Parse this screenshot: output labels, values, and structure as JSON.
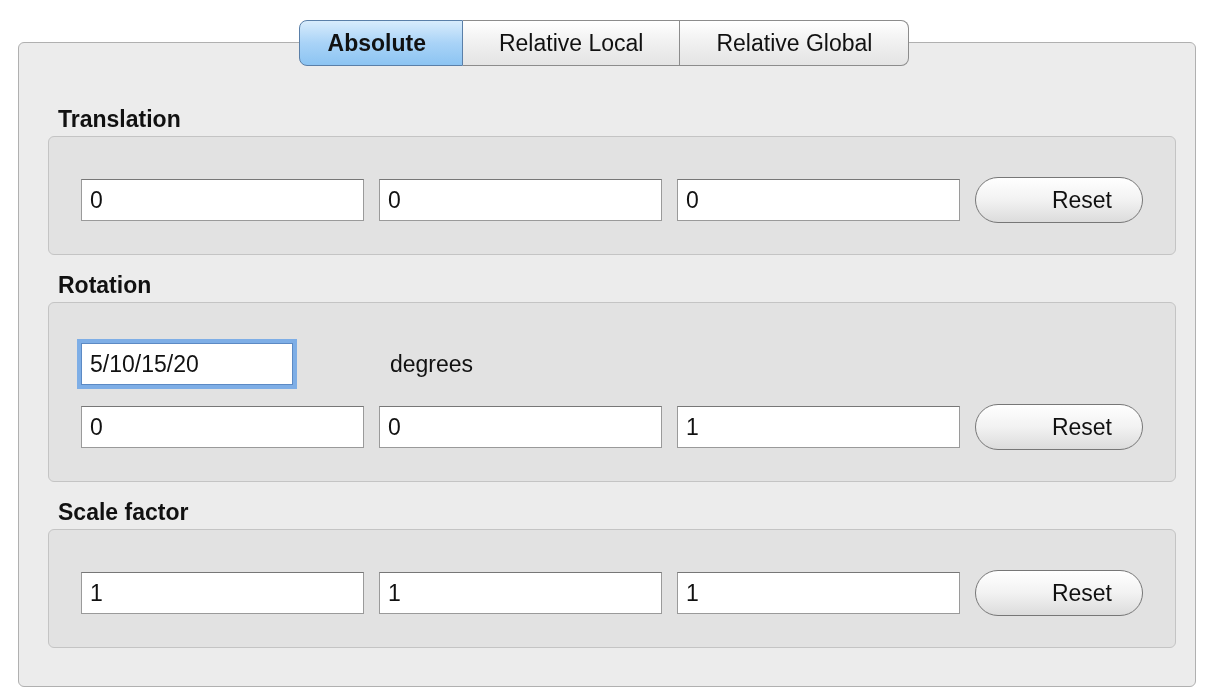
{
  "tabs": [
    {
      "label": "Absolute",
      "selected": true
    },
    {
      "label": "Relative Local",
      "selected": false
    },
    {
      "label": "Relative Global",
      "selected": false
    }
  ],
  "sections": [
    {
      "title": "Translation",
      "fields": [
        "0",
        "0",
        "0"
      ],
      "reset": "Reset"
    },
    {
      "title": "Rotation",
      "angle": {
        "value": "5/10/15/20",
        "focused": true,
        "unit": "degrees"
      },
      "fields": [
        "0",
        "0",
        "1"
      ],
      "reset": "Reset"
    },
    {
      "title": "Scale factor",
      "fields": [
        "1",
        "1",
        "1"
      ],
      "reset": "Reset"
    }
  ]
}
